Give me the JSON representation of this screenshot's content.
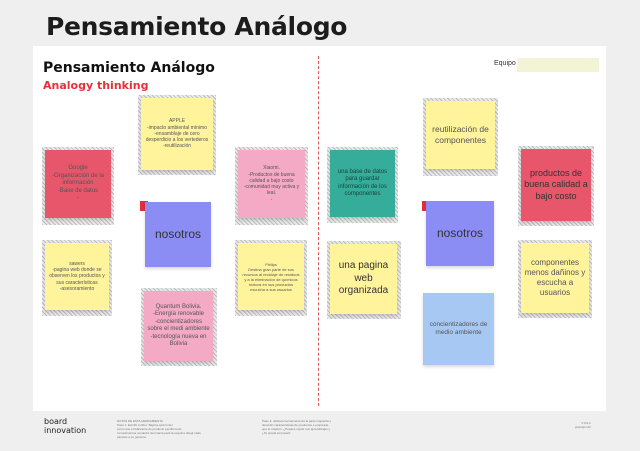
{
  "page": {
    "heading": "Pensamiento Análogo"
  },
  "board": {
    "title": "Pensamiento Análogo",
    "subtitle": "Analogy thinking",
    "team_label": "Equipo",
    "team_value": ""
  },
  "colors": {
    "yellow": "#fff49c",
    "pink": "#f4a9c5",
    "red": "#e8566b",
    "teal": "#35ad9a",
    "purple": "#8c8cf5",
    "blue": "#a7c8f2",
    "accent": "#e8303a"
  },
  "left": {
    "apple": "APPLE\n-impacto ambiental mínimo\n-ensamblaje de cero desperdicio a los vertederos\n-reutilización",
    "google": "Google\n-Organización de la información\n-Base de datos\n-",
    "xiaomi": "Xiaomi.\n-Productos de buena calidad a bajo costo\n-comunidad muy activa y leal.\n-",
    "center": "nosotros",
    "sawers": "sawers\n-pagina web donde se observen los productos y sus características\n-asesoramiento",
    "philips": "Philips\nDestina gran parte de sus recursos al reciclaje de residuos y a la eliminación de químicos tóxicos en sus productos\nescucha a sus usuarios",
    "quantum": "Quantum Bolivia.\n-Energía renovable\n-concientizadores sobre el medi ambiente\n-tecnología nueva en Bolivia"
  },
  "right": {
    "reuse": "reutilización de componentes",
    "database": "una base de datos para guardar información de los componentes",
    "quality": "productos de buena calidad a bajo costo",
    "center": "nosotros",
    "webpage": "una pagina web organizada",
    "components": "componentes menos dañinos y escucha a usuarios",
    "awareness": "concientizadores de medio ambiente"
  },
  "footer": {
    "logo_line1": "board",
    "logo_line2": "innovation",
    "text1": "NOTAS DE ESTA HERRAMIENTA\nPaso 1: Escribí tu libro. Bajá la opción del\npunto que el fabricante de producto escribir todo\nconocimientos vendedor del marca para la esquina. Elegí cada\npaneles a su persona.",
    "text2": "Paso 2: utiliza la herramienta de la parte izquierda y\ndescubrí características de productos o empresas\nque te inspiren. ¿Puedes copiar sus aprendizajes y\n¿Te propia empresa?",
    "right": "V 0.0.1\nprototipo #1"
  }
}
